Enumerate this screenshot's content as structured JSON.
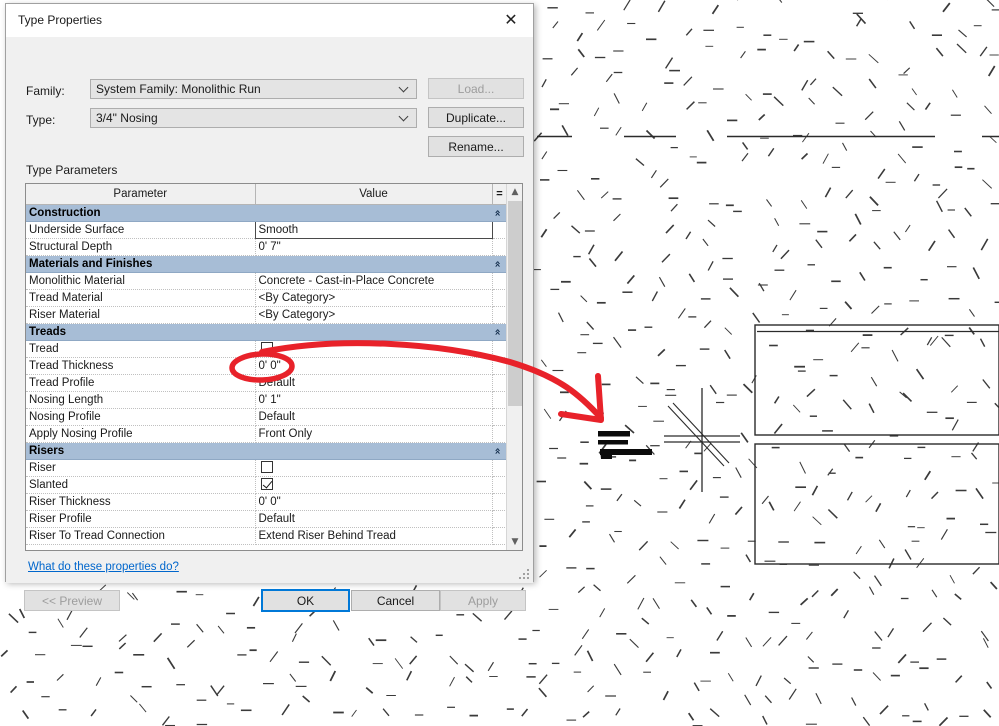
{
  "dialog": {
    "title": "Type Properties",
    "close_icon": "close-icon",
    "family_label": "Family:",
    "family_value": "System Family: Monolithic Run",
    "type_label": "Type:",
    "type_value": "3/4\" Nosing",
    "buttons": {
      "load": "Load...",
      "duplicate": "Duplicate...",
      "rename": "Rename..."
    },
    "type_parameters_label": "Type Parameters",
    "help_link": "What do these properties do?",
    "footer": {
      "preview": "<< Preview",
      "ok": "OK",
      "cancel": "Cancel",
      "apply": "Apply"
    },
    "table": {
      "columns": [
        "Parameter",
        "Value",
        "="
      ],
      "collapse_icon": "chevron-collapse-icon",
      "rows": [
        {
          "kind": "group",
          "label": "Construction"
        },
        {
          "kind": "param",
          "name": "Underside Surface",
          "value": "Smooth",
          "dim": false,
          "editing": true
        },
        {
          "kind": "param",
          "name": "Structural Depth",
          "value": "0'  7\"",
          "dim": false
        },
        {
          "kind": "group",
          "label": "Materials and Finishes"
        },
        {
          "kind": "param",
          "name": "Monolithic Material",
          "value": "Concrete - Cast-in-Place Concrete",
          "dim": false
        },
        {
          "kind": "param",
          "name": "Tread Material",
          "value": "<By Category>",
          "dim": true
        },
        {
          "kind": "param",
          "name": "Riser Material",
          "value": "<By Category>",
          "dim": true
        },
        {
          "kind": "group",
          "label": "Treads"
        },
        {
          "kind": "checkbox",
          "name": "Tread",
          "checked": false,
          "dim": false
        },
        {
          "kind": "param",
          "name": "Tread Thickness",
          "value": "0'  0\"",
          "dim": true
        },
        {
          "kind": "param",
          "name": "Tread Profile",
          "value": "Default",
          "dim": true
        },
        {
          "kind": "param",
          "name": "Nosing Length",
          "value": "0'  1\"",
          "dim": false,
          "highlighted": true
        },
        {
          "kind": "param",
          "name": "Nosing Profile",
          "value": "Default",
          "dim": false
        },
        {
          "kind": "param",
          "name": "Apply Nosing Profile",
          "value": "Front Only",
          "dim": true
        },
        {
          "kind": "group",
          "label": "Risers"
        },
        {
          "kind": "checkbox",
          "name": "Riser",
          "checked": false,
          "dim": false
        },
        {
          "kind": "checkbox",
          "name": "Slanted",
          "checked": true,
          "dim": false
        },
        {
          "kind": "param",
          "name": "Riser Thickness",
          "value": "0'  0\"",
          "dim": true
        },
        {
          "kind": "param",
          "name": "Riser Profile",
          "value": "Default",
          "dim": true
        },
        {
          "kind": "param",
          "name": "Riser To Tread Connection",
          "value": "Extend Riser Behind Tread",
          "dim": true
        }
      ]
    },
    "scrollbar": {
      "up_icon": "chevron-up-icon",
      "down_icon": "chevron-down-icon"
    }
  },
  "annotation": {
    "color": "#e8222a",
    "ellipse_target": "0'  1\"",
    "shape": "ellipse-and-arrow"
  },
  "canvas": {
    "description": "Revit section view of concrete stair with hatch pattern",
    "hatch_color": "#3a3a3a",
    "line_color": "#2b2b2b"
  }
}
